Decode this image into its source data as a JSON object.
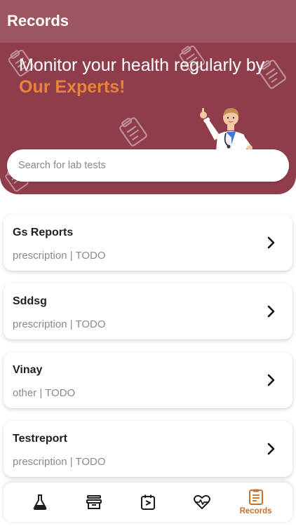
{
  "appbar": {
    "title": "Records"
  },
  "hero": {
    "headline": "Monitor your health regularly by",
    "headline_accent": "Our Experts!",
    "search_placeholder": "Search for lab tests"
  },
  "records": [
    {
      "title": "Gs Reports",
      "subtitle": "prescription | TODO"
    },
    {
      "title": "Sddsg",
      "subtitle": "prescription | TODO"
    },
    {
      "title": "Vinay",
      "subtitle": "other | TODO"
    },
    {
      "title": "Testreport",
      "subtitle": "prescription | TODO"
    }
  ],
  "nav": {
    "items": [
      {
        "icon": "flask-icon",
        "label": ""
      },
      {
        "icon": "archive-icon",
        "label": ""
      },
      {
        "icon": "calendar-icon",
        "label": ""
      },
      {
        "icon": "heartbeat-icon",
        "label": ""
      },
      {
        "icon": "records-icon",
        "label": "Records",
        "active": true
      }
    ],
    "active_color": "#c86f2c"
  },
  "colors": {
    "hero": "#8f3d4b",
    "appbar": "#9d5562",
    "accent": "#e8833a"
  }
}
